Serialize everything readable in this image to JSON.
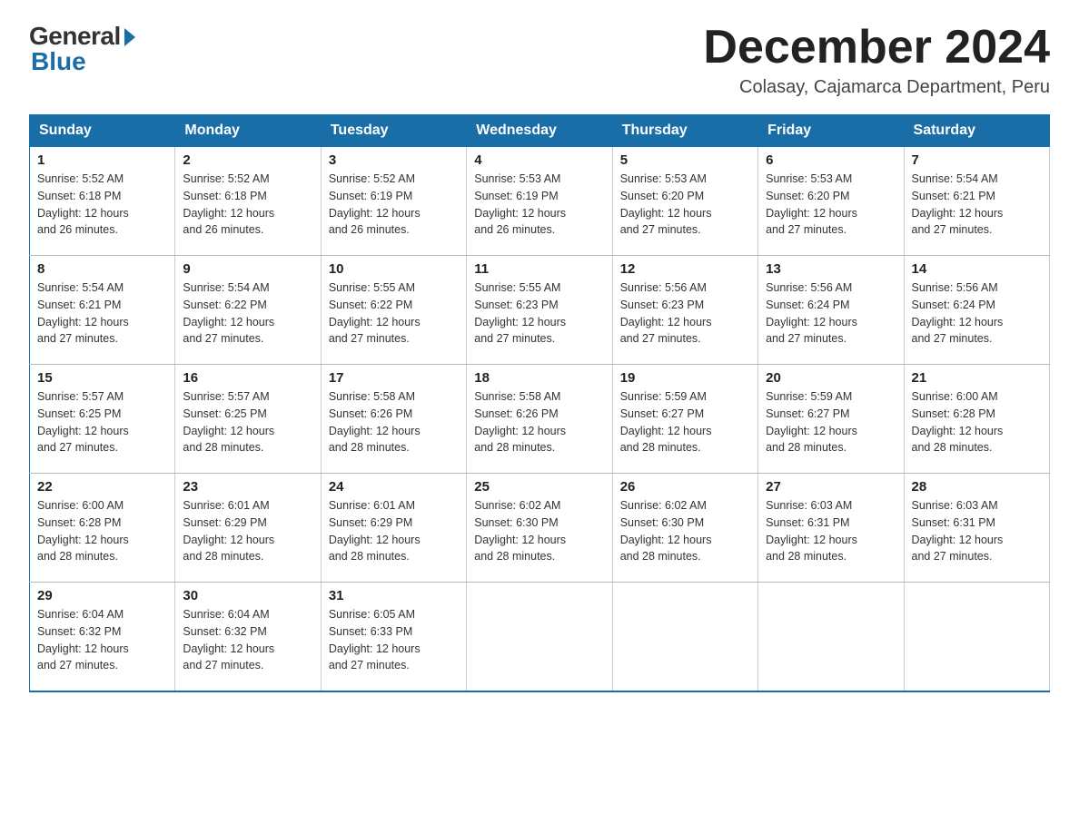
{
  "logo": {
    "general": "General",
    "blue": "Blue"
  },
  "header": {
    "month": "December 2024",
    "location": "Colasay, Cajamarca Department, Peru"
  },
  "days_of_week": [
    "Sunday",
    "Monday",
    "Tuesday",
    "Wednesday",
    "Thursday",
    "Friday",
    "Saturday"
  ],
  "weeks": [
    [
      {
        "day": "1",
        "sunrise": "5:52 AM",
        "sunset": "6:18 PM",
        "daylight": "12 hours and 26 minutes."
      },
      {
        "day": "2",
        "sunrise": "5:52 AM",
        "sunset": "6:18 PM",
        "daylight": "12 hours and 26 minutes."
      },
      {
        "day": "3",
        "sunrise": "5:52 AM",
        "sunset": "6:19 PM",
        "daylight": "12 hours and 26 minutes."
      },
      {
        "day": "4",
        "sunrise": "5:53 AM",
        "sunset": "6:19 PM",
        "daylight": "12 hours and 26 minutes."
      },
      {
        "day": "5",
        "sunrise": "5:53 AM",
        "sunset": "6:20 PM",
        "daylight": "12 hours and 27 minutes."
      },
      {
        "day": "6",
        "sunrise": "5:53 AM",
        "sunset": "6:20 PM",
        "daylight": "12 hours and 27 minutes."
      },
      {
        "day": "7",
        "sunrise": "5:54 AM",
        "sunset": "6:21 PM",
        "daylight": "12 hours and 27 minutes."
      }
    ],
    [
      {
        "day": "8",
        "sunrise": "5:54 AM",
        "sunset": "6:21 PM",
        "daylight": "12 hours and 27 minutes."
      },
      {
        "day": "9",
        "sunrise": "5:54 AM",
        "sunset": "6:22 PM",
        "daylight": "12 hours and 27 minutes."
      },
      {
        "day": "10",
        "sunrise": "5:55 AM",
        "sunset": "6:22 PM",
        "daylight": "12 hours and 27 minutes."
      },
      {
        "day": "11",
        "sunrise": "5:55 AM",
        "sunset": "6:23 PM",
        "daylight": "12 hours and 27 minutes."
      },
      {
        "day": "12",
        "sunrise": "5:56 AM",
        "sunset": "6:23 PM",
        "daylight": "12 hours and 27 minutes."
      },
      {
        "day": "13",
        "sunrise": "5:56 AM",
        "sunset": "6:24 PM",
        "daylight": "12 hours and 27 minutes."
      },
      {
        "day": "14",
        "sunrise": "5:56 AM",
        "sunset": "6:24 PM",
        "daylight": "12 hours and 27 minutes."
      }
    ],
    [
      {
        "day": "15",
        "sunrise": "5:57 AM",
        "sunset": "6:25 PM",
        "daylight": "12 hours and 27 minutes."
      },
      {
        "day": "16",
        "sunrise": "5:57 AM",
        "sunset": "6:25 PM",
        "daylight": "12 hours and 28 minutes."
      },
      {
        "day": "17",
        "sunrise": "5:58 AM",
        "sunset": "6:26 PM",
        "daylight": "12 hours and 28 minutes."
      },
      {
        "day": "18",
        "sunrise": "5:58 AM",
        "sunset": "6:26 PM",
        "daylight": "12 hours and 28 minutes."
      },
      {
        "day": "19",
        "sunrise": "5:59 AM",
        "sunset": "6:27 PM",
        "daylight": "12 hours and 28 minutes."
      },
      {
        "day": "20",
        "sunrise": "5:59 AM",
        "sunset": "6:27 PM",
        "daylight": "12 hours and 28 minutes."
      },
      {
        "day": "21",
        "sunrise": "6:00 AM",
        "sunset": "6:28 PM",
        "daylight": "12 hours and 28 minutes."
      }
    ],
    [
      {
        "day": "22",
        "sunrise": "6:00 AM",
        "sunset": "6:28 PM",
        "daylight": "12 hours and 28 minutes."
      },
      {
        "day": "23",
        "sunrise": "6:01 AM",
        "sunset": "6:29 PM",
        "daylight": "12 hours and 28 minutes."
      },
      {
        "day": "24",
        "sunrise": "6:01 AM",
        "sunset": "6:29 PM",
        "daylight": "12 hours and 28 minutes."
      },
      {
        "day": "25",
        "sunrise": "6:02 AM",
        "sunset": "6:30 PM",
        "daylight": "12 hours and 28 minutes."
      },
      {
        "day": "26",
        "sunrise": "6:02 AM",
        "sunset": "6:30 PM",
        "daylight": "12 hours and 28 minutes."
      },
      {
        "day": "27",
        "sunrise": "6:03 AM",
        "sunset": "6:31 PM",
        "daylight": "12 hours and 28 minutes."
      },
      {
        "day": "28",
        "sunrise": "6:03 AM",
        "sunset": "6:31 PM",
        "daylight": "12 hours and 27 minutes."
      }
    ],
    [
      {
        "day": "29",
        "sunrise": "6:04 AM",
        "sunset": "6:32 PM",
        "daylight": "12 hours and 27 minutes."
      },
      {
        "day": "30",
        "sunrise": "6:04 AM",
        "sunset": "6:32 PM",
        "daylight": "12 hours and 27 minutes."
      },
      {
        "day": "31",
        "sunrise": "6:05 AM",
        "sunset": "6:33 PM",
        "daylight": "12 hours and 27 minutes."
      },
      null,
      null,
      null,
      null
    ]
  ],
  "labels": {
    "sunrise": "Sunrise:",
    "sunset": "Sunset:",
    "daylight": "Daylight:"
  }
}
